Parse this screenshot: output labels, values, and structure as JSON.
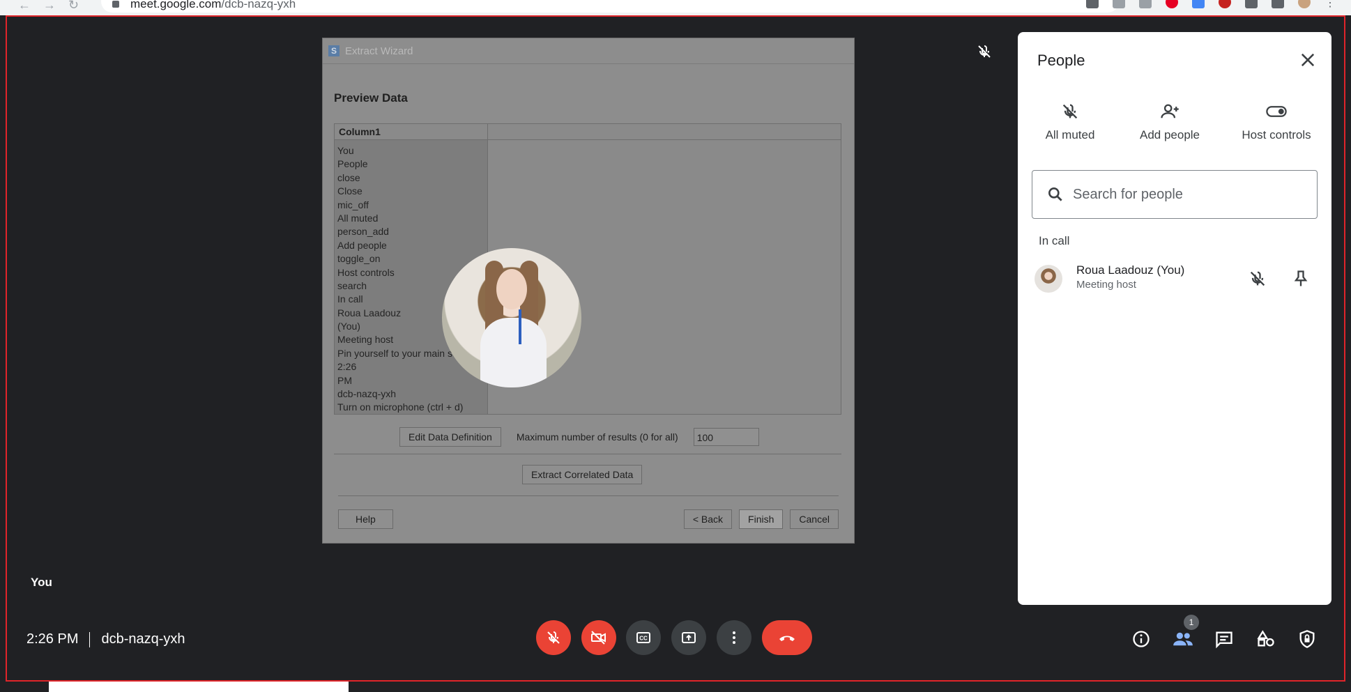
{
  "browser": {
    "url_host": "meet.google.com",
    "url_path": "/dcb-nazq-yxh"
  },
  "shared_window": {
    "title": "Extract Wizard",
    "heading": "Preview Data",
    "column_header": "Column1",
    "rows": [
      "You",
      "People",
      "close",
      "Close",
      "mic_off",
      "All muted",
      "person_add",
      "Add people",
      "toggle_on",
      "Host controls",
      "search",
      "In call",
      "Roua Laadouz",
      "(You)",
      "Meeting host",
      "Pin yourself to your main screen.",
      "2:26",
      "PM",
      "dcb-nazq-yxh",
      "Turn on microphone (ctrl + d)"
    ],
    "edit_button": "Edit Data Definition",
    "max_results_label": "Maximum number of results (0 for all)",
    "max_results_value": "100",
    "extract_button": "Extract Correlated Data",
    "help_button": "Help",
    "back_button": "< Back",
    "finish_button": "Finish",
    "cancel_button": "Cancel"
  },
  "tile": {
    "name": "You"
  },
  "people_panel": {
    "title": "People",
    "actions": {
      "all_muted": "All muted",
      "add_people": "Add people",
      "host_controls": "Host controls"
    },
    "search_placeholder": "Search for people",
    "section_label": "In call",
    "participants": [
      {
        "name": "Roua Laadouz (You)",
        "role": "Meeting host"
      }
    ]
  },
  "meeting": {
    "time": "2:26 PM",
    "code": "dcb-nazq-yxh"
  },
  "people_badge": "1",
  "colors": {
    "red": "#ea4335",
    "dark": "#202124",
    "control_gray": "#3c4043",
    "accent_blue": "#8ab4f8"
  }
}
